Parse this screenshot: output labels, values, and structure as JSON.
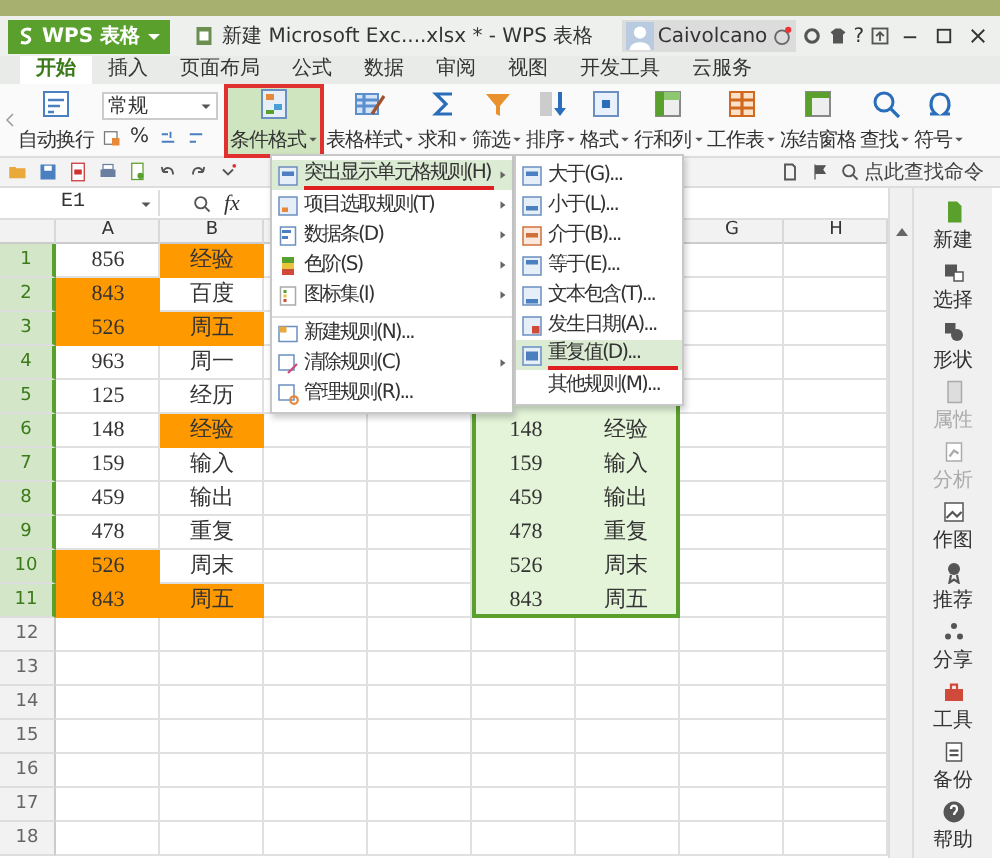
{
  "app_button": {
    "label": "WPS 表格"
  },
  "window": {
    "title": "新建 Microsoft Exc....xlsx * - WPS 表格",
    "user": "Caivolcano",
    "help": "?"
  },
  "tabs": [
    {
      "label": "开始",
      "selected": true
    },
    {
      "label": "插入",
      "selected": false
    },
    {
      "label": "页面布局",
      "selected": false
    },
    {
      "label": "公式",
      "selected": false
    },
    {
      "label": "数据",
      "selected": false
    },
    {
      "label": "审阅",
      "selected": false
    },
    {
      "label": "视图",
      "selected": false
    },
    {
      "label": "开发工具",
      "selected": false
    },
    {
      "label": "云服务",
      "selected": false
    }
  ],
  "ribbon": {
    "wrap_label": "自动换行",
    "number_format": "常规",
    "percent": "%",
    "commands": [
      {
        "kind": "cond",
        "label": "条件格式",
        "selected": true,
        "dropdown": true
      },
      {
        "kind": "style",
        "label": "表格样式",
        "selected": false,
        "dropdown": true
      },
      {
        "kind": "sum",
        "label": "求和",
        "selected": false,
        "dropdown": true
      },
      {
        "kind": "filter",
        "label": "筛选",
        "selected": false,
        "dropdown": true
      },
      {
        "kind": "sort",
        "label": "排序",
        "selected": false,
        "dropdown": true
      },
      {
        "kind": "format",
        "label": "格式",
        "selected": false,
        "dropdown": true
      },
      {
        "kind": "rowcol",
        "label": "行和列",
        "selected": false,
        "dropdown": true
      },
      {
        "kind": "sheet",
        "label": "工作表",
        "selected": false,
        "dropdown": true
      },
      {
        "kind": "freeze",
        "label": "冻结窗格",
        "selected": false,
        "dropdown": false
      },
      {
        "kind": "find",
        "label": "查找",
        "selected": false,
        "dropdown": true
      },
      {
        "kind": "symbol",
        "label": "符号",
        "selected": false,
        "dropdown": true
      }
    ]
  },
  "command_search": {
    "placeholder": "点此查找命令"
  },
  "formula_bar": {
    "name_box": "E1",
    "fx": "fx"
  },
  "columns": [
    {
      "label": "A"
    },
    {
      "label": "B"
    },
    {},
    {},
    {},
    {},
    {
      "label": "G"
    },
    {
      "label": "H"
    }
  ],
  "rows": [
    {
      "number": "1",
      "in_selection": true,
      "a": {
        "text": "856",
        "highlighted": false
      },
      "b": {
        "text": "经验",
        "highlighted": true
      }
    },
    {
      "number": "2",
      "in_selection": true,
      "a": {
        "text": "843",
        "highlighted": true
      },
      "b": {
        "text": "百度",
        "highlighted": false
      }
    },
    {
      "number": "3",
      "in_selection": true,
      "a": {
        "text": "526",
        "highlighted": true
      },
      "b": {
        "text": "周五",
        "highlighted": true
      }
    },
    {
      "number": "4",
      "in_selection": true,
      "a": {
        "text": "963",
        "highlighted": false
      },
      "b": {
        "text": "周一",
        "highlighted": false
      }
    },
    {
      "number": "5",
      "in_selection": true,
      "a": {
        "text": "125",
        "highlighted": false
      },
      "b": {
        "text": "经历",
        "highlighted": false
      }
    },
    {
      "number": "6",
      "in_selection": true,
      "a": {
        "text": "148",
        "highlighted": false
      },
      "b": {
        "text": "经验",
        "highlighted": true
      },
      "e": "148",
      "f": "经验"
    },
    {
      "number": "7",
      "in_selection": true,
      "a": {
        "text": "159",
        "highlighted": false
      },
      "b": {
        "text": "输入",
        "highlighted": false
      },
      "e": "159",
      "f": "输入"
    },
    {
      "number": "8",
      "in_selection": true,
      "a": {
        "text": "459",
        "highlighted": false
      },
      "b": {
        "text": "输出",
        "highlighted": false
      },
      "e": "459",
      "f": "输出"
    },
    {
      "number": "9",
      "in_selection": true,
      "a": {
        "text": "478",
        "highlighted": false
      },
      "b": {
        "text": "重复",
        "highlighted": false
      },
      "e": "478",
      "f": "重复"
    },
    {
      "number": "10",
      "in_selection": true,
      "a": {
        "text": "526",
        "highlighted": true
      },
      "b": {
        "text": "周末",
        "highlighted": false
      },
      "e": "526",
      "f": "周末"
    },
    {
      "number": "11",
      "in_selection": true,
      "a": {
        "text": "843",
        "highlighted": true
      },
      "b": {
        "text": "周五",
        "highlighted": true
      },
      "e": "843",
      "f": "周五"
    },
    {
      "number": "12",
      "in_selection": false
    },
    {
      "number": "13",
      "in_selection": false
    },
    {
      "number": "14",
      "in_selection": false
    },
    {
      "number": "15",
      "in_selection": false
    },
    {
      "number": "16",
      "in_selection": false
    },
    {
      "number": "17",
      "in_selection": false
    },
    {
      "number": "18",
      "in_selection": false
    }
  ],
  "menu": {
    "items": [
      {
        "kind": "highlight",
        "label": "突出显示单元格规则(H)",
        "submenu": true,
        "selected": true,
        "separator_before": false
      },
      {
        "kind": "topbottom",
        "label": "项目选取规则(T)",
        "submenu": true,
        "selected": false,
        "separator_before": false
      },
      {
        "kind": "databar",
        "label": "数据条(D)",
        "submenu": true,
        "selected": false,
        "separator_before": false
      },
      {
        "kind": "colorscale",
        "label": "色阶(S)",
        "submenu": true,
        "selected": false,
        "separator_before": false
      },
      {
        "kind": "iconset",
        "label": "图标集(I)",
        "submenu": true,
        "selected": false,
        "separator_before": false
      },
      {
        "kind": "new",
        "label": "新建规则(N)...",
        "submenu": false,
        "selected": false,
        "separator_before": true
      },
      {
        "kind": "clear",
        "label": "清除规则(C)",
        "submenu": true,
        "selected": false,
        "separator_before": false
      },
      {
        "kind": "manage",
        "label": "管理规则(R)...",
        "submenu": false,
        "selected": false,
        "separator_before": false
      }
    ]
  },
  "submenu": {
    "items": [
      {
        "kind": "greater",
        "label": "大于(G)...",
        "selected": false
      },
      {
        "kind": "less",
        "label": "小于(L)...",
        "selected": false
      },
      {
        "kind": "between",
        "label": "介于(B)...",
        "selected": false
      },
      {
        "kind": "equal",
        "label": "等于(E)...",
        "selected": false
      },
      {
        "kind": "text",
        "label": "文本包含(T)...",
        "selected": false
      },
      {
        "kind": "date",
        "label": "发生日期(A)...",
        "selected": false
      },
      {
        "kind": "duplicate",
        "label": "重复值(D)...",
        "selected": true
      },
      {
        "kind": "plain",
        "label": "其他规则(M)...",
        "selected": false
      }
    ]
  },
  "sidebar": [
    {
      "kind": "new",
      "label": "新建",
      "disabled": false
    },
    {
      "kind": "select",
      "label": "选择",
      "disabled": false
    },
    {
      "kind": "shape",
      "label": "形状",
      "disabled": false
    },
    {
      "kind": "props",
      "label": "属性",
      "disabled": true
    },
    {
      "kind": "analyze",
      "label": "分析",
      "disabled": true
    },
    {
      "kind": "chart",
      "label": "作图",
      "disabled": false
    },
    {
      "kind": "recommend",
      "label": "推荐",
      "disabled": false
    },
    {
      "kind": "share",
      "label": "分享",
      "disabled": false
    },
    {
      "kind": "tools",
      "label": "工具",
      "disabled": false
    },
    {
      "kind": "backup",
      "label": "备份",
      "disabled": false
    },
    {
      "kind": "help",
      "label": "帮助",
      "disabled": false
    }
  ]
}
